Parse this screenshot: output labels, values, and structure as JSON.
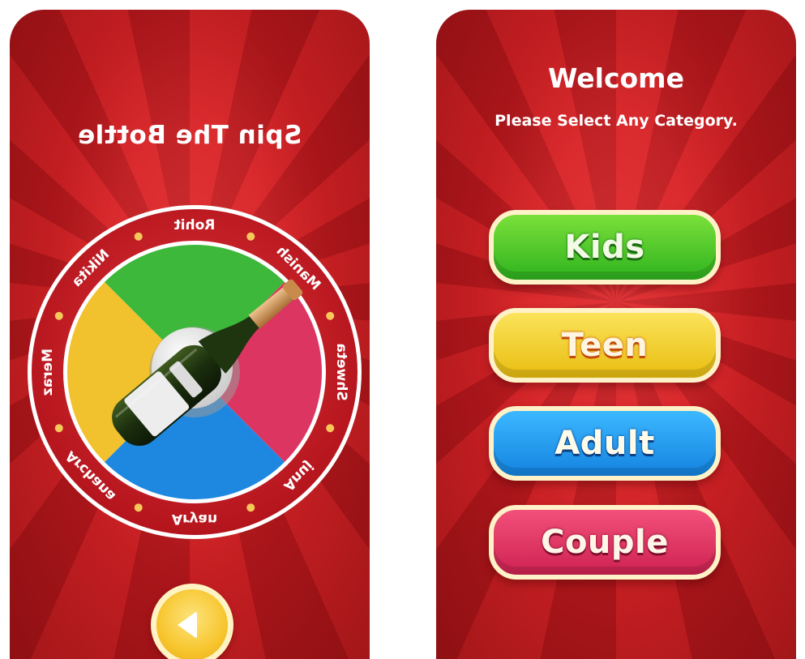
{
  "left_screen": {
    "title": "Spin The Bottle",
    "wheel_names": [
      "Rohit",
      "Manish",
      "Shweta",
      "Anuj",
      "Aryan",
      "Archana",
      "Meraz",
      "Nikita"
    ],
    "segment_colors": {
      "green": "#3db83a",
      "pink": "#dc3561",
      "blue": "#1e88e0",
      "yellow": "#f2c12e"
    },
    "rim_color": "#c81d27",
    "back_icon": "play-back-icon"
  },
  "right_screen": {
    "welcome": "Welcome",
    "subtitle": "Please Select Any Category.",
    "categories": [
      {
        "label": "Kids",
        "color": "#3bbf25"
      },
      {
        "label": "Teen",
        "color": "#f1cd24"
      },
      {
        "label": "Adult",
        "color": "#1f9cf0"
      },
      {
        "label": "Couple",
        "color": "#e0356a"
      }
    ]
  }
}
